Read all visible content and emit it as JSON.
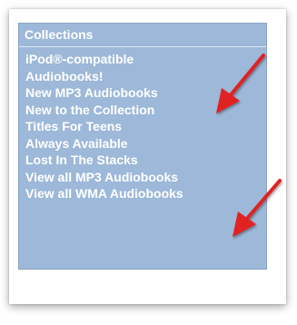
{
  "collections": {
    "title": "Collections",
    "items": [
      {
        "label": "iPod®-compatible Audiobooks!"
      },
      {
        "label": "New MP3 Audiobooks"
      },
      {
        "label": "New to the Collection"
      },
      {
        "label": "Titles For Teens"
      },
      {
        "label": "Always Available"
      },
      {
        "label": "Lost In The Stacks"
      },
      {
        "label": "View all MP3 Audiobooks"
      },
      {
        "label": "View all WMA Audiobooks"
      }
    ]
  },
  "colors": {
    "panel_background": "#9db8d8",
    "link_text": "#ffffff",
    "annotation_arrow": "#e02020"
  },
  "annotations": [
    {
      "icon": "red-arrow-icon",
      "points_to": "New MP3 Audiobooks"
    },
    {
      "icon": "red-arrow-icon",
      "points_to": "View all MP3 Audiobooks"
    }
  ]
}
